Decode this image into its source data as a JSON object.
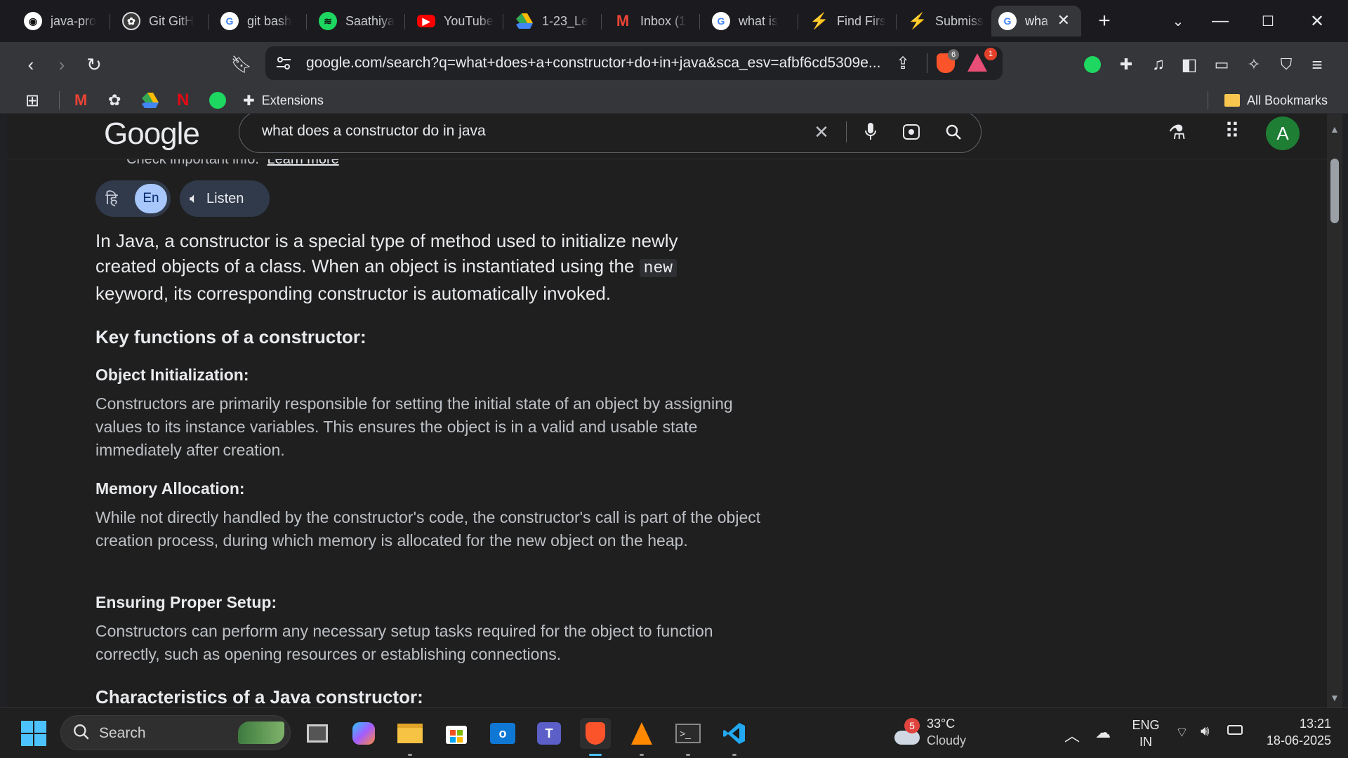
{
  "tabs": [
    {
      "label": "java-pro",
      "icon": "github-icon"
    },
    {
      "label": "Git GitH",
      "icon": "chatgpt-icon"
    },
    {
      "label": "git bash",
      "icon": "google-icon"
    },
    {
      "label": "Saathiya",
      "icon": "spotify-icon"
    },
    {
      "label": "YouTube",
      "icon": "youtube-icon"
    },
    {
      "label": "1-23_Le",
      "icon": "google-drive-icon"
    },
    {
      "label": "Inbox (1",
      "icon": "gmail-icon"
    },
    {
      "label": "what is",
      "icon": "google-icon"
    },
    {
      "label": "Find Firs",
      "icon": "leetcode-icon"
    },
    {
      "label": "Submiss",
      "icon": "leetcode-icon"
    },
    {
      "label": "wha",
      "icon": "google-icon",
      "active": true
    }
  ],
  "toolbar": {
    "url": "google.com/search?q=what+does+a+constructor+do+in+java&sca_esv=afbf6cd5309e...",
    "brave_shield_count": "6",
    "rewards_count": "1"
  },
  "bookmarks": {
    "extensions_label": "Extensions",
    "all_bookmarks": "All Bookmarks"
  },
  "google": {
    "logo": "Google",
    "query": "what does a constructor do in java",
    "avatar_letter": "A"
  },
  "answer": {
    "cutoff_text": "Check important info.",
    "cutoff_link": "Learn more",
    "lang_hi": "हि",
    "lang_en": "En",
    "listen_label": "Listen",
    "intro_1": "In Java, a constructor is a special type of method used to initialize newly created objects of a class. When an object is instantiated using the ",
    "intro_code": "new",
    "intro_2": " keyword, its corresponding constructor is automatically invoked.",
    "key_heading": "Key functions of a constructor:",
    "sections": [
      {
        "title": "Object Initialization:",
        "body": "Constructors are primarily responsible for setting the initial state of an object by assigning values to its instance variables. This ensures the object is in a valid and usable state immediately after creation."
      },
      {
        "title": "Memory Allocation:",
        "body": "While not directly handled by the constructor's code, the constructor's call is part of the object creation process, during which memory is allocated for the new object on the heap."
      },
      {
        "title": "Ensuring Proper Setup:",
        "body": "Constructors can perform any necessary setup tasks required for the object to function correctly, such as opening resources or establishing connections."
      }
    ],
    "char_heading": "Characteristics of a Java constructor:"
  },
  "taskbar": {
    "search_label": "Search",
    "weather_badge": "5",
    "temperature": "33°C",
    "condition": "Cloudy",
    "lang_line1": "ENG",
    "lang_line2": "IN",
    "time": "13:21",
    "date": "18-06-2025"
  },
  "colors": {
    "accent": "#a8c7fa",
    "avatar": "#1e7e34",
    "page_bg": "#1f1f1f",
    "chrome_bg": "#35363a"
  }
}
